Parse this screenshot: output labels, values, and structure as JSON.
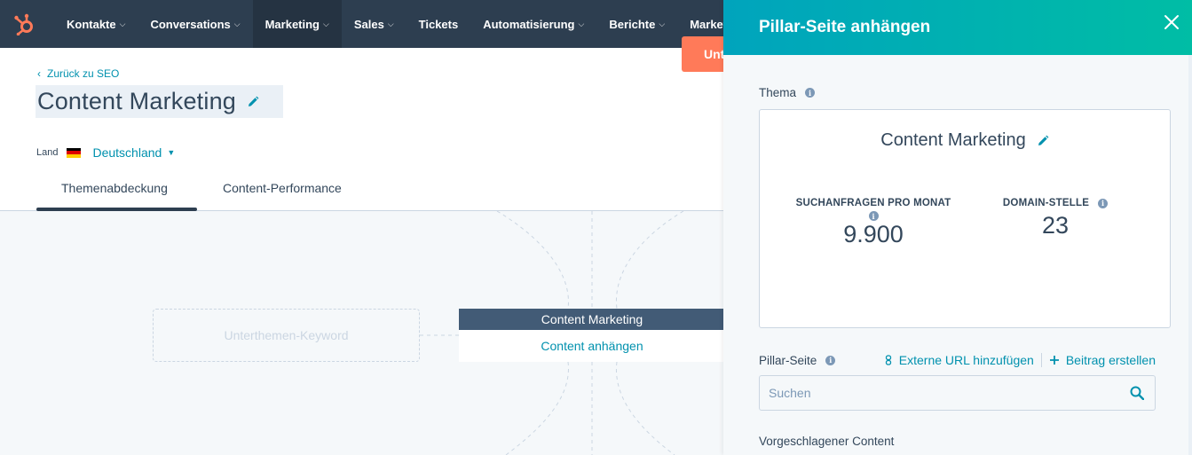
{
  "nav": {
    "items": [
      {
        "label": "Kontakte",
        "has_chevron": true,
        "active": false
      },
      {
        "label": "Conversations",
        "has_chevron": true,
        "active": false
      },
      {
        "label": "Marketing",
        "has_chevron": true,
        "active": true
      },
      {
        "label": "Sales",
        "has_chevron": true,
        "active": false
      },
      {
        "label": "Tickets",
        "has_chevron": false,
        "active": false
      },
      {
        "label": "Automatisierung",
        "has_chevron": true,
        "active": false
      },
      {
        "label": "Berichte",
        "has_chevron": true,
        "active": false
      },
      {
        "label": "Marketp",
        "has_chevron": false,
        "active": false
      }
    ],
    "chevron": "⌵"
  },
  "header": {
    "back_link": "Zurück zu SEO",
    "back_arrow": "‹",
    "title": "Content Marketing",
    "land_label": "Land",
    "country": "Deutschland",
    "country_caret": "▼",
    "cta_label": "Unt",
    "tabs": [
      "Themenabdeckung",
      "Content-Performance"
    ],
    "active_tab": 0
  },
  "canvas": {
    "subtopic_placeholder": "Unterthemen-Keyword",
    "pillar_title": "Content Marketing",
    "pillar_action": "Content anhängen"
  },
  "panel": {
    "title": "Pillar-Seite anhängen",
    "thema_label": "Thema",
    "card": {
      "title": "Content Marketing",
      "stats": [
        {
          "label": "SUCHANFRAGEN PRO MONAT",
          "value": "9.900"
        },
        {
          "label": "DOMAIN-STELLE",
          "value": "23"
        }
      ]
    },
    "pillar_label": "Pillar-Seite",
    "add_url_label": "Externe URL hinzufügen",
    "create_post_label": "Beitrag erstellen",
    "search_placeholder": "Suchen",
    "suggested_label": "Vorgeschlagener Content"
  },
  "colors": {
    "nav_bg": "#2d3e50",
    "nav_active": "#253342",
    "accent_orange": "#ff7a59",
    "link_teal": "#0091ae",
    "panel_gradient_start": "#00a4bd",
    "panel_gradient_end": "#00bda5",
    "text_dark": "#33475b",
    "pillar_head": "#425b76"
  },
  "icons": {
    "logo": "hubspot-sprocket-icon",
    "edit": "pencil-icon",
    "info": "info-icon",
    "close": "close-icon",
    "link": "link-icon",
    "plus": "plus-icon",
    "search": "search-icon",
    "flag": "germany-flag-icon"
  }
}
